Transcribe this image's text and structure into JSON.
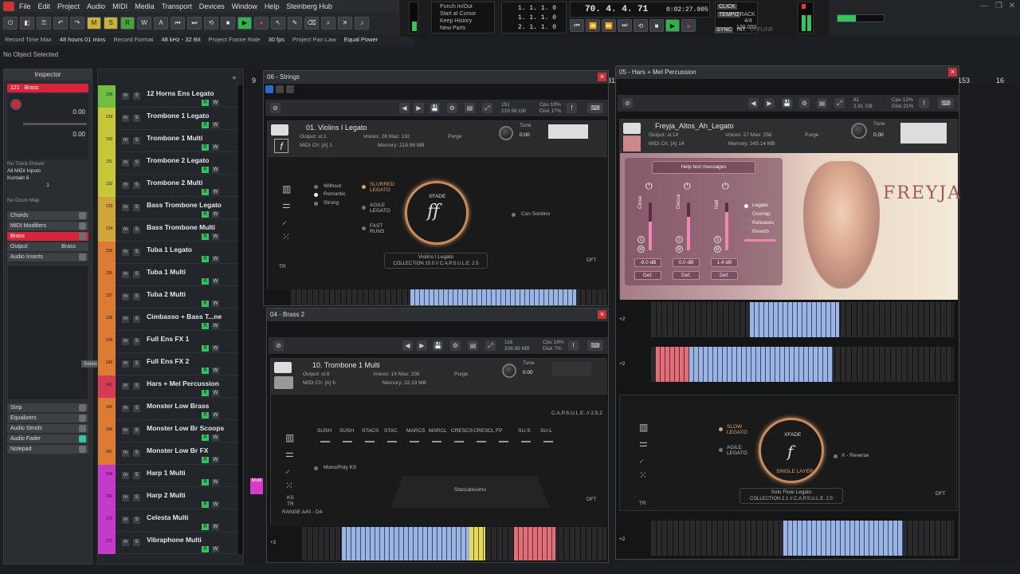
{
  "menu": [
    "File",
    "Edit",
    "Project",
    "Audio",
    "MIDI",
    "Media",
    "Transport",
    "Devices",
    "Window",
    "Help",
    "Steinberg Hub"
  ],
  "toolbar": {
    "mode_buttons": [
      "M",
      "S",
      "R",
      "W",
      "A"
    ]
  },
  "info": {
    "record_time_label": "Record Time Max",
    "record_time": "48 hours 01 mins",
    "record_format_label": "Record Format",
    "record_format": "48 kHz - 32 Bit",
    "frame_rate_label": "Project Frame Rate",
    "frame_rate": "30 fps",
    "pan_law_label": "Project Pan Law",
    "pan_law": "Equal Power"
  },
  "status": "No Object Selected",
  "transport": {
    "punch_in": "Punch In/Out",
    "start_at_cursor": "Start at Cursor",
    "keep_history": "Keep History",
    "new_parts": "New Parts",
    "left_locator": "1. 1. 1. 0",
    "right_locator": "1. 1. 1. 0",
    "pos3": "2. 1. 1. 0",
    "primary_time": "70. 4. 4. 71",
    "secondary_time": "0:02:27.905",
    "click": "CLICK",
    "tempo_label": "TEMPO",
    "track_label": "TRACK",
    "signature": "4/4",
    "tempo": "120.000",
    "sync": "SYNC",
    "int": "INT.",
    "offline": "OFFLINE"
  },
  "inspector": {
    "title": "Inspector",
    "track_num": "121",
    "track_name": "Brass",
    "vol1": "0.00",
    "vol2": "0.00",
    "no_track_preset": "No Track Preset",
    "all_midi": "All MIDI Inputs",
    "kontakt": "Kontakt 6",
    "no_drum_map": "No Drum Map",
    "chan": "1",
    "sections": [
      "Chords",
      "MIDI Modifiers",
      "Brass",
      "Output:",
      "Audio Inserts",
      "Strip",
      "Equalizers",
      "Audio Sends",
      "Audio Fader",
      "Notepad"
    ],
    "output_value": "Brass",
    "select_tooltip": "Select Object"
  },
  "tracks": [
    {
      "num": "228",
      "name": "12 Horns Ens Legato",
      "color": "#6fbf44"
    },
    {
      "num": "229",
      "name": "Trombone 1 Legato",
      "color": "#c6c83a"
    },
    {
      "num": "230",
      "name": "Trombone 1 Multi",
      "color": "#c6c83a"
    },
    {
      "num": "231",
      "name": "Trombone 2 Legato",
      "color": "#c6c83a"
    },
    {
      "num": "232",
      "name": "Trombone 2 Multi",
      "color": "#c6c83a"
    },
    {
      "num": "233",
      "name": "Bass Trombone Legato",
      "color": "#d0a638"
    },
    {
      "num": "234",
      "name": "Bass Trombone Multi",
      "color": "#d0a638"
    },
    {
      "num": "235",
      "name": "Tuba 1 Legato",
      "color": "#dd7a34"
    },
    {
      "num": "236",
      "name": "Tuba 1 Multi",
      "color": "#dd7a34"
    },
    {
      "num": "237",
      "name": "Tuba 2 Multi",
      "color": "#dd7a34"
    },
    {
      "num": "238",
      "name": "Cimbasso + Bass T...ne",
      "color": "#dd7a34"
    },
    {
      "num": "239",
      "name": "Full Ens FX 1",
      "color": "#dd7a34"
    },
    {
      "num": "240",
      "name": "Full Ens FX 2",
      "color": "#dd7a34"
    },
    {
      "num": "241",
      "name": "Hars + Mel Percussion",
      "color": "#d63a55"
    },
    {
      "num": "265",
      "name": "Monster Low Brass",
      "color": "#dd7a34"
    },
    {
      "num": "266",
      "name": "Monster Low Br Scoops",
      "color": "#dd7a34"
    },
    {
      "num": "267",
      "name": "Monster Low Br FX",
      "color": "#dd7a34"
    },
    {
      "num": "268",
      "name": "Harp 1 Multi",
      "color": "#c63acb"
    },
    {
      "num": "269",
      "name": "Harp 2 Multi",
      "color": "#c63acb"
    },
    {
      "num": "270",
      "name": "Celesta Multi",
      "color": "#c63acb"
    },
    {
      "num": "271",
      "name": "Vibraphone Multi",
      "color": "#c63acb"
    }
  ],
  "ruler": {
    "bar9": "9",
    "bar81": "81",
    "bar153": "153",
    "bar16": "16"
  },
  "multi_tag": "Multi",
  "strings": {
    "win_title": "06 - Strings",
    "inst_name": "01. Violins I Legato",
    "output": "st.1",
    "voices": "26",
    "max": "192",
    "midi_ch": "[A] 1",
    "memory": "218.98 MB",
    "purge": "Purge",
    "tune": "Tune",
    "tune_val": "0.00",
    "art1": "Without",
    "art2": "Romantic",
    "art3": "Strong",
    "mode1": "SLURRED",
    "mode1b": "LEGATO",
    "mode2": "AGILE",
    "mode2b": "LEGATO",
    "mode3": "FAST",
    "mode3b": "RUNS",
    "xfade": "XFADE",
    "con_sordino": "Con Sordino",
    "patch": "Violins I Legato",
    "collection": "COLLECTION 10.0  //  C.A.P.S.U.L.E. 2.5",
    "dft": "DFT",
    "tr": "TR",
    "cpu": "Cpu 18%",
    "disk": "Disk 17%",
    "mem": "151",
    "mem2": "218.98 GB"
  },
  "brass": {
    "win_title": "04 - Brass 2",
    "inst_name": "10. Trombone 1 Multi",
    "output": "st.6",
    "voices": "14",
    "max": "256",
    "midi_ch": "[A] 6",
    "memory": "32.19 MB",
    "purge": "Purge",
    "tune": "Tune",
    "tune_val": "0.00",
    "caps": "C.A.P.S.U.L.E. // 2.5.2",
    "arts": [
      "SUSH",
      "SUSH",
      "STACS",
      "STAC",
      "MARCS",
      "MARCL",
      "CRESCS",
      "CRESCL",
      "FP",
      "SU-S",
      "SU-L"
    ],
    "mono_poly": "Mono/Poly KS",
    "patch": "Staccatissimo",
    "ks": "KS",
    "tr": "TR",
    "range": "RANGE A#0 - D4",
    "dft": "DFT",
    "cpu": "Cpu 16%",
    "disk": "Disk 7%",
    "mem": "116",
    "mem2": "336.99 MB"
  },
  "hars": {
    "win_title": "05 - Hars + Mel Percussion",
    "inst_name": "Freyja_Altos_Ah_Legato",
    "output": "st.14",
    "voices": "27",
    "max": "256",
    "midi_ch": "[A] 14",
    "memory": "345.14 MB",
    "purge": "Purge",
    "tune": "Tune",
    "tune_val": "0.00",
    "help": "Help text messages",
    "brand": "FREYJA",
    "mics": [
      "Close",
      "Decca",
      "Hall"
    ],
    "mic_vals": [
      "-9.0 dB",
      "0.0 dB",
      "1.4 dB"
    ],
    "def": "Def.",
    "opts": [
      "Legato",
      "Overlap",
      "Releases",
      "Reverb"
    ],
    "cpu": "Cpu 12%",
    "disk": "Disk 21%",
    "mem": "81",
    "mem2": "2.81 GB",
    "mode1": "SLOW",
    "mode1b": "LEGATO",
    "mode2": "AGILE",
    "mode2b": "LEGATO",
    "xfade": "XFADE",
    "layer": "SINGLE LAYER",
    "xreverse": "X - Reverse",
    "patch": "Solo Flute Legato",
    "collection": "COLLECTION 2.1  //  C.A.P.S.U.L.E. 2.5",
    "dft": "DFT",
    "tr": "TR"
  },
  "kbd_label": "+2"
}
